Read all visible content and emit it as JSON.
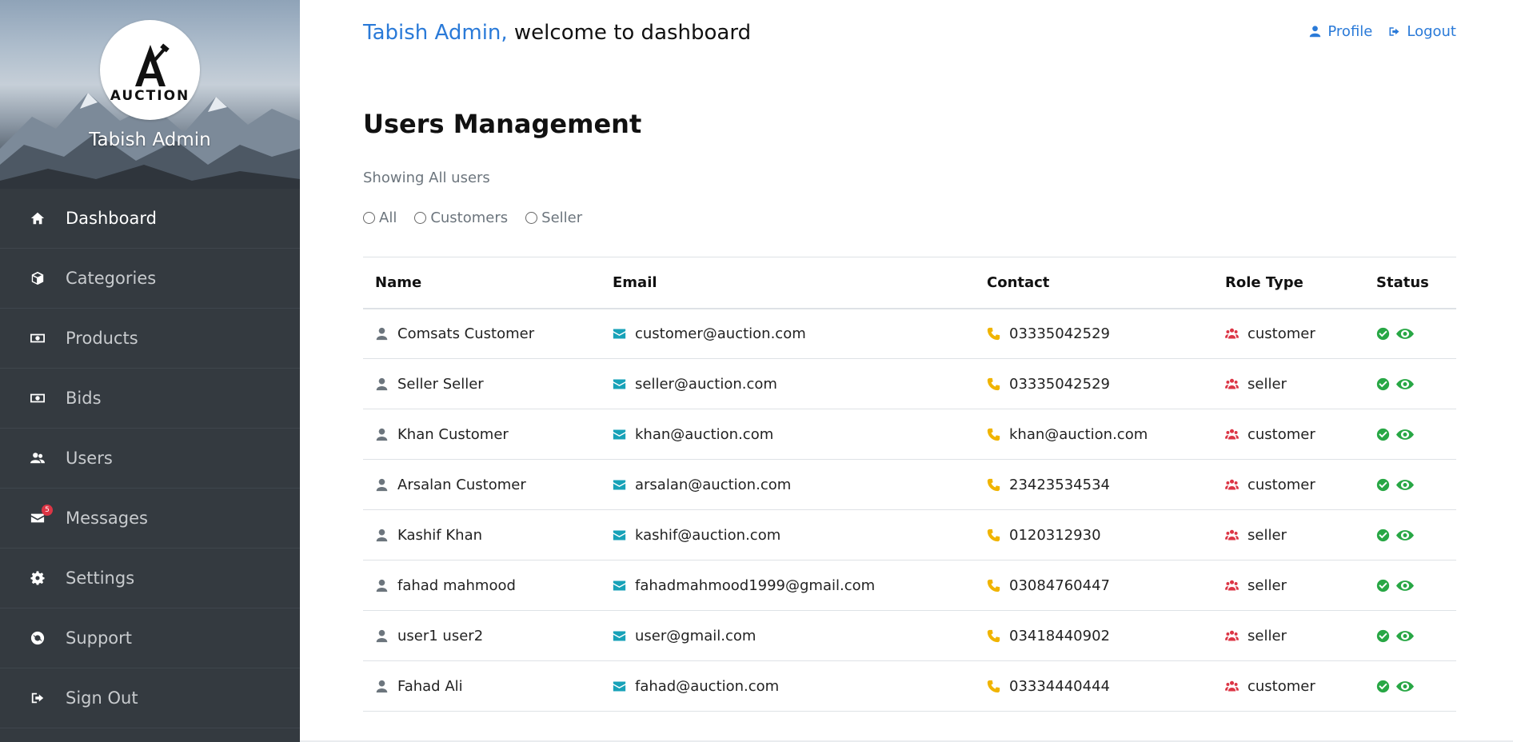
{
  "sidebar": {
    "logo_text": "AUCTION",
    "admin_name": "Tabish Admin",
    "items": [
      {
        "label": "Dashboard",
        "icon": "home-icon"
      },
      {
        "label": "Categories",
        "icon": "cube-icon"
      },
      {
        "label": "Products",
        "icon": "money-icon"
      },
      {
        "label": "Bids",
        "icon": "money-icon"
      },
      {
        "label": "Users",
        "icon": "users-icon"
      },
      {
        "label": "Messages",
        "icon": "envelope-icon",
        "badge": "5"
      },
      {
        "label": "Settings",
        "icon": "gear-icon"
      },
      {
        "label": "Support",
        "icon": "life-ring-icon"
      },
      {
        "label": "Sign Out",
        "icon": "sign-out-icon"
      }
    ]
  },
  "header": {
    "welcome_name": "Tabish Admin,",
    "welcome_rest": " welcome to dashboard",
    "profile_label": "Profile",
    "logout_label": "Logout"
  },
  "main": {
    "title": "Users Management",
    "showing": "Showing All users",
    "filters": [
      "All",
      "Customers",
      "Seller"
    ]
  },
  "table": {
    "columns": [
      "Name",
      "Email",
      "Contact",
      "Role Type",
      "Status"
    ],
    "rows": [
      {
        "name": "Comsats Customer",
        "email": "customer@auction.com",
        "contact": "03335042529",
        "role": "customer"
      },
      {
        "name": "Seller Seller",
        "email": "seller@auction.com",
        "contact": "03335042529",
        "role": "seller"
      },
      {
        "name": "Khan Customer",
        "email": "khan@auction.com",
        "contact": "khan@auction.com",
        "role": "customer"
      },
      {
        "name": "Arsalan Customer",
        "email": "arsalan@auction.com",
        "contact": "23423534534",
        "role": "customer"
      },
      {
        "name": "Kashif Khan",
        "email": "kashif@auction.com",
        "contact": "0120312930",
        "role": "seller"
      },
      {
        "name": "fahad mahmood",
        "email": "fahadmahmood1999@gmail.com",
        "contact": "03084760447",
        "role": "seller"
      },
      {
        "name": "user1 user2",
        "email": "user@gmail.com",
        "contact": "03418440902",
        "role": "seller"
      },
      {
        "name": "Fahad Ali",
        "email": "fahad@auction.com",
        "contact": "03334440444",
        "role": "customer"
      }
    ]
  },
  "colors": {
    "sidebar_bg": "#343a40",
    "accent_blue": "#2a7ad8",
    "mail_icon": "#17a2b8",
    "phone_icon": "#f0b400",
    "role_icon": "#dc3545",
    "status_icon": "#28a745"
  }
}
